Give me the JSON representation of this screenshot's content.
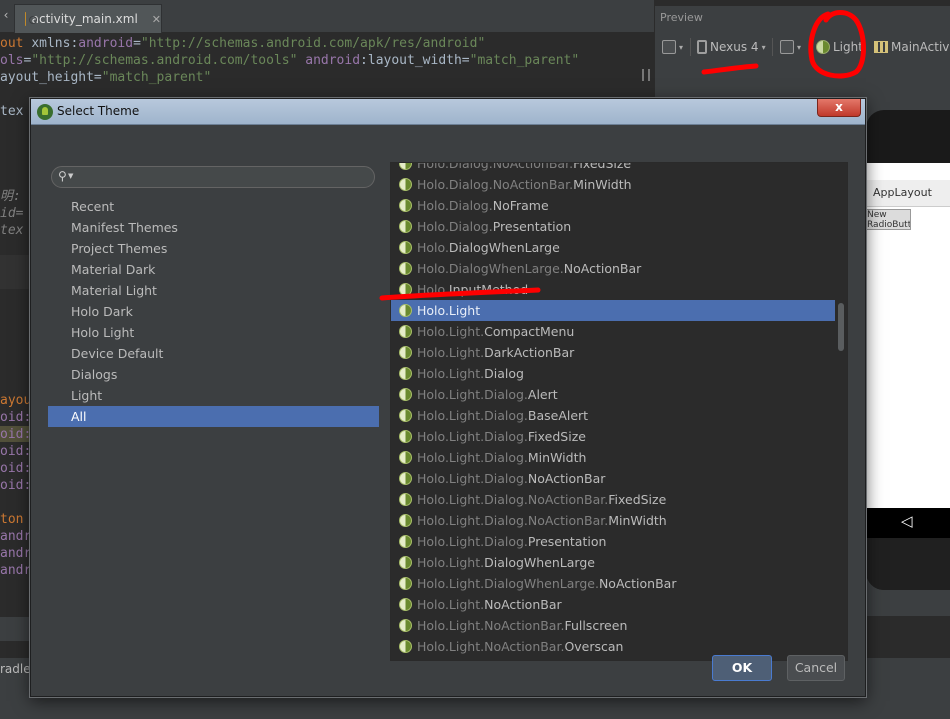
{
  "editor": {
    "tab_label": "activity_main.xml",
    "lines": [
      {
        "parts": [
          [
            "kw",
            "out "
          ],
          [
            "plain",
            "xmlns:"
          ],
          [
            "ns",
            "android"
          ],
          [
            "plain",
            "="
          ],
          [
            "str",
            "\"http://schemas.android.com/apk/res/android\""
          ]
        ]
      },
      {
        "parts": [
          [
            "ns",
            "ols"
          ],
          [
            "plain",
            "="
          ],
          [
            "str",
            "\"http://schemas.android.com/tools\" "
          ],
          [
            "ns",
            "android"
          ],
          [
            "plain",
            ":layout_width="
          ],
          [
            "str",
            "\"match_parent\""
          ]
        ]
      },
      {
        "parts": [
          [
            "plain",
            "ayout_height="
          ],
          [
            "str",
            "\"match_parent\""
          ]
        ]
      },
      {
        "parts": [
          [
            "plain",
            "tex"
          ]
        ]
      },
      {
        "parts": [
          [
            "cmt",
            "明:"
          ]
        ]
      },
      {
        "parts": [
          [
            "cmt",
            "id="
          ]
        ]
      },
      {
        "parts": [
          [
            "cmt",
            "tex"
          ]
        ]
      },
      {
        "parts": [
          [
            "kw",
            "ayou"
          ]
        ]
      },
      {
        "parts": [
          [
            "ns",
            "oid:"
          ]
        ]
      },
      {
        "parts": [
          [
            "ns",
            "oid:"
          ]
        ]
      },
      {
        "parts": [
          [
            "ns",
            "oid:"
          ]
        ]
      },
      {
        "parts": [
          [
            "ns",
            "oid:"
          ]
        ]
      },
      {
        "parts": [
          [
            "ns",
            "oid:"
          ]
        ]
      },
      {
        "parts": [
          [
            "kw",
            "ton"
          ]
        ]
      },
      {
        "parts": [
          [
            "ns",
            "andr"
          ]
        ]
      },
      {
        "parts": [
          [
            "ns",
            "andr"
          ]
        ]
      },
      {
        "parts": [
          [
            "ns",
            "andr"
          ]
        ]
      }
    ]
  },
  "status": {
    "gradle_label": "radle"
  },
  "preview": {
    "title": "Preview",
    "device_label": "Nexus 4",
    "theme_label": "Light",
    "activity_label": "MainActivit",
    "device_app_title": "AppLayout",
    "device_widget_text": "New RadioButton Button",
    "nav_back": "◁"
  },
  "dialog": {
    "title": "Select Theme",
    "close_label": "x",
    "search": {
      "value": "",
      "placeholder": ""
    },
    "categories": [
      {
        "label": "Recent",
        "selected": false
      },
      {
        "label": "Manifest Themes",
        "selected": false
      },
      {
        "label": "Project Themes",
        "selected": false
      },
      {
        "label": "Material Dark",
        "selected": false
      },
      {
        "label": "Material Light",
        "selected": false
      },
      {
        "label": "Holo Dark",
        "selected": false
      },
      {
        "label": "Holo Light",
        "selected": false
      },
      {
        "label": "Device Default",
        "selected": false
      },
      {
        "label": "Dialogs",
        "selected": false
      },
      {
        "label": "Light",
        "selected": false
      },
      {
        "label": "All",
        "selected": true
      }
    ],
    "themes": [
      {
        "prefix": "Holo.Dialog.NoActionBar.",
        "leaf": "FixedSize",
        "selected": false
      },
      {
        "prefix": "Holo.Dialog.NoActionBar.",
        "leaf": "MinWidth",
        "selected": false
      },
      {
        "prefix": "Holo.Dialog.",
        "leaf": "NoFrame",
        "selected": false
      },
      {
        "prefix": "Holo.Dialog.",
        "leaf": "Presentation",
        "selected": false
      },
      {
        "prefix": "Holo.",
        "leaf": "DialogWhenLarge",
        "selected": false
      },
      {
        "prefix": "Holo.DialogWhenLarge.",
        "leaf": "NoActionBar",
        "selected": false
      },
      {
        "prefix": "Holo.",
        "leaf": "InputMethod",
        "selected": false
      },
      {
        "prefix": "Holo.",
        "leaf": "Light",
        "selected": true
      },
      {
        "prefix": "Holo.Light.",
        "leaf": "CompactMenu",
        "selected": false
      },
      {
        "prefix": "Holo.Light.",
        "leaf": "DarkActionBar",
        "selected": false
      },
      {
        "prefix": "Holo.Light.",
        "leaf": "Dialog",
        "selected": false
      },
      {
        "prefix": "Holo.Light.Dialog.",
        "leaf": "Alert",
        "selected": false
      },
      {
        "prefix": "Holo.Light.Dialog.",
        "leaf": "BaseAlert",
        "selected": false
      },
      {
        "prefix": "Holo.Light.Dialog.",
        "leaf": "FixedSize",
        "selected": false
      },
      {
        "prefix": "Holo.Light.Dialog.",
        "leaf": "MinWidth",
        "selected": false
      },
      {
        "prefix": "Holo.Light.Dialog.",
        "leaf": "NoActionBar",
        "selected": false
      },
      {
        "prefix": "Holo.Light.Dialog.NoActionBar.",
        "leaf": "FixedSize",
        "selected": false
      },
      {
        "prefix": "Holo.Light.Dialog.NoActionBar.",
        "leaf": "MinWidth",
        "selected": false
      },
      {
        "prefix": "Holo.Light.Dialog.",
        "leaf": "Presentation",
        "selected": false
      },
      {
        "prefix": "Holo.Light.",
        "leaf": "DialogWhenLarge",
        "selected": false
      },
      {
        "prefix": "Holo.Light.DialogWhenLarge.",
        "leaf": "NoActionBar",
        "selected": false
      },
      {
        "prefix": "Holo.Light.",
        "leaf": "NoActionBar",
        "selected": false
      },
      {
        "prefix": "Holo.Light.NoActionBar.",
        "leaf": "Fullscreen",
        "selected": false
      },
      {
        "prefix": "Holo.Light.NoActionBar.",
        "leaf": "Overscan",
        "selected": false
      }
    ],
    "ok_label": "OK",
    "cancel_label": "Cancel"
  },
  "colors": {
    "selection": "#4b6eaf",
    "dialog_bg": "#3c3f41",
    "list_bg": "#2b2b2b",
    "annotation_red": "#ff0000"
  }
}
